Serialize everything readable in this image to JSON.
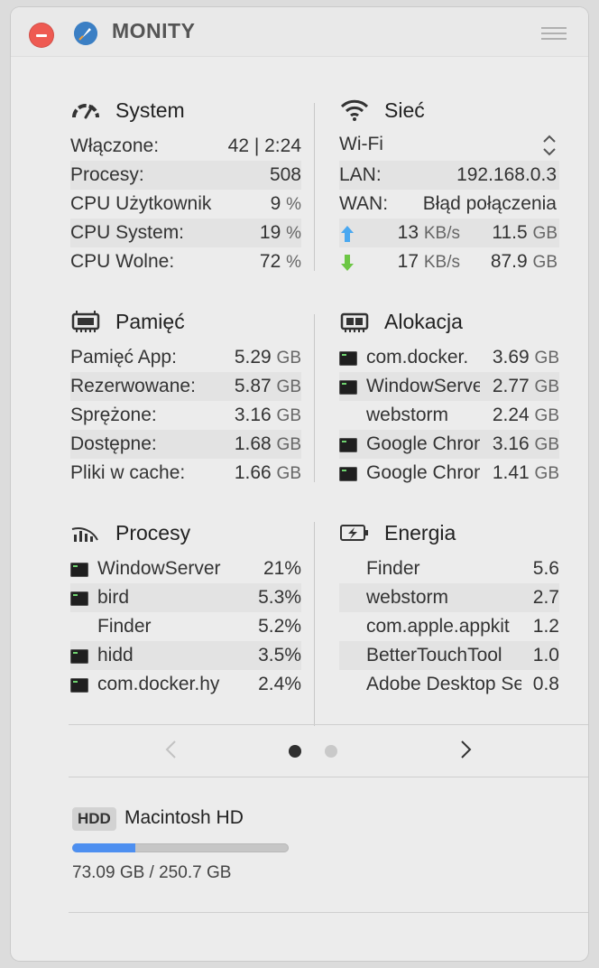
{
  "app": {
    "title": "MONITY"
  },
  "system": {
    "title": "System",
    "rows": [
      {
        "label": "Włączone:",
        "value": "42 | 2:24",
        "unit": ""
      },
      {
        "label": "Procesy:",
        "value": "508",
        "unit": ""
      },
      {
        "label": "CPU Użytkownik",
        "value": "9",
        "unit": "%"
      },
      {
        "label": "CPU System:",
        "value": "19",
        "unit": "%"
      },
      {
        "label": "CPU Wolne:",
        "value": "72",
        "unit": "%"
      }
    ]
  },
  "network": {
    "title": "Sieć",
    "interface": "Wi-Fi",
    "lan_label": "LAN:",
    "lan_value": "192.168.0.3",
    "wan_label": "WAN:",
    "wan_value": "Błąd połączenia",
    "upload": {
      "rate": "13",
      "rate_unit": "KB/s",
      "total": "11.5",
      "total_unit": "GB"
    },
    "download": {
      "rate": "17",
      "rate_unit": "KB/s",
      "total": "87.9",
      "total_unit": "GB"
    }
  },
  "memory": {
    "title": "Pamięć",
    "rows": [
      {
        "label": "Pamięć App:",
        "value": "5.29",
        "unit": "GB"
      },
      {
        "label": "Rezerwowane:",
        "value": "5.87",
        "unit": "GB"
      },
      {
        "label": "Sprężone:",
        "value": "3.16",
        "unit": "GB"
      },
      {
        "label": "Dostępne:",
        "value": "1.68",
        "unit": "GB"
      },
      {
        "label": "Pliki w cache:",
        "value": "1.66",
        "unit": "GB"
      }
    ]
  },
  "allocation": {
    "title": "Alokacja",
    "rows": [
      {
        "name": "com.docker.",
        "value": "3.69",
        "unit": "GB",
        "icon": true
      },
      {
        "name": "WindowServer",
        "value": "2.77",
        "unit": "GB",
        "icon": true
      },
      {
        "name": "webstorm",
        "value": "2.24",
        "unit": "GB",
        "icon": false
      },
      {
        "name": "Google Chrome",
        "value": "3.16",
        "unit": "GB",
        "icon": true
      },
      {
        "name": "Google Chrome",
        "value": "1.41",
        "unit": "GB",
        "icon": true
      }
    ]
  },
  "processes": {
    "title": "Procesy",
    "rows": [
      {
        "name": "WindowServer",
        "value": "21%",
        "icon": true
      },
      {
        "name": "bird",
        "value": "5.3%",
        "icon": true
      },
      {
        "name": "Finder",
        "value": "5.2%",
        "icon": false
      },
      {
        "name": "hidd",
        "value": "3.5%",
        "icon": true
      },
      {
        "name": "com.docker.hy",
        "value": "2.4%",
        "icon": true
      }
    ]
  },
  "energy": {
    "title": "Energia",
    "rows": [
      {
        "name": "Finder",
        "value": "5.6"
      },
      {
        "name": "webstorm",
        "value": "2.7"
      },
      {
        "name": "com.apple.appkit",
        "value": "1.2"
      },
      {
        "name": "BetterTouchTool",
        "value": "1.0"
      },
      {
        "name": "Adobe Desktop Service",
        "value": "0.8"
      }
    ]
  },
  "pager": {
    "pages": 2,
    "current": 1
  },
  "disk": {
    "badge": "HDD",
    "name": "Macintosh HD",
    "usage": "73.09 GB / 250.7 GB",
    "used_fraction": 0.2915
  },
  "colors": {
    "close": "#ee5a52",
    "upload_arrow": "#4aa8f0",
    "download_arrow": "#6cc644",
    "disk_fill": "#4d8ff0"
  }
}
